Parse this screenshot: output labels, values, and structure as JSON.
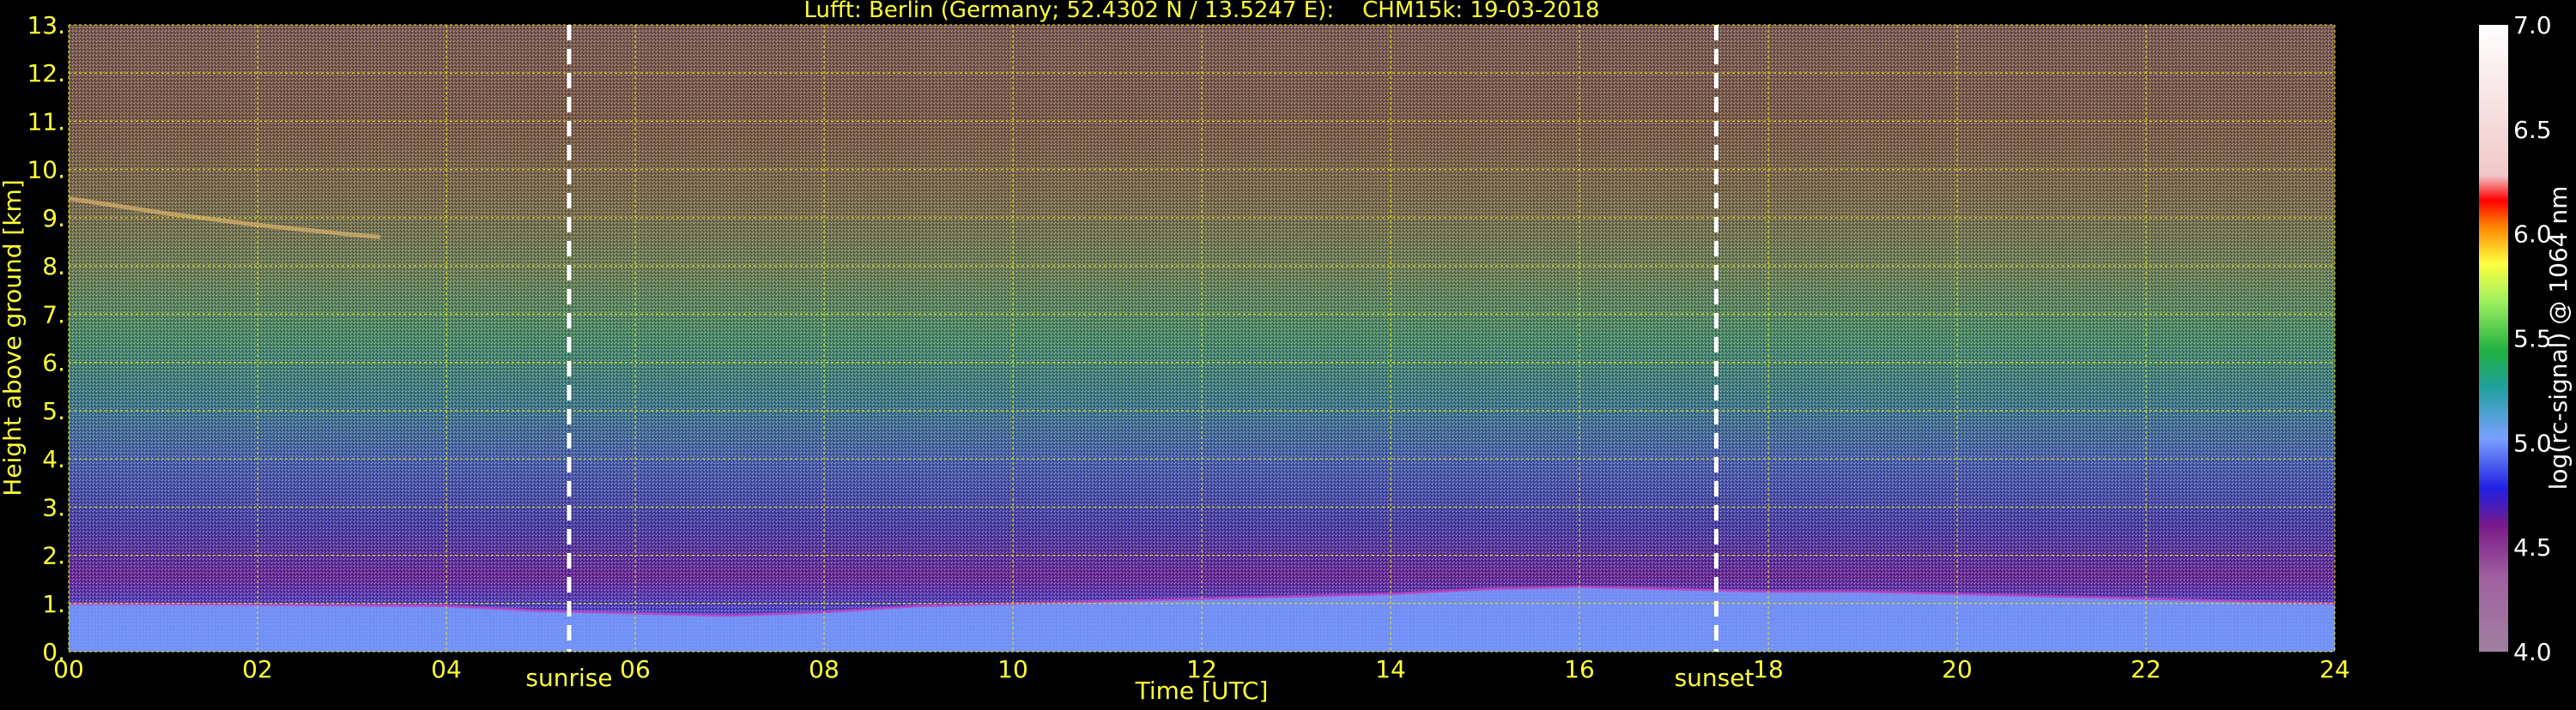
{
  "chart_data": {
    "type": "heatmap",
    "title": "Lufft: Berlin (Germany; 52.4302 N / 13.5247 E):    CHM15k: 19-03-2018",
    "xlabel": "Time [UTC]",
    "ylabel": "Height above ground [km]",
    "xlim": [
      0,
      24
    ],
    "ylim": [
      0,
      13
    ],
    "x_ticks": [
      "00",
      "02",
      "04",
      "06",
      "08",
      "10",
      "12",
      "14",
      "16",
      "18",
      "20",
      "22",
      "24"
    ],
    "y_ticks": [
      "0.",
      "1.",
      "2.",
      "3.",
      "4.",
      "5.",
      "6.",
      "7.",
      "8.",
      "9.",
      "10.",
      "11.",
      "12.",
      "13."
    ],
    "grid": true,
    "annotations": [
      {
        "label": "sunrise",
        "x": 5.3
      },
      {
        "label": "sunset",
        "x": 17.45
      }
    ],
    "colorbar": {
      "label": "log(rc-signal) @ 1064 nm",
      "range": [
        4.0,
        7.0
      ],
      "ticks": [
        "4.0",
        "4.5",
        "5.0",
        "5.5",
        "6.0",
        "6.5",
        "7.0"
      ]
    },
    "boundary_layer_top_km": {
      "x": [
        0,
        2,
        4,
        5,
        6,
        7,
        8,
        9,
        10,
        11,
        12,
        13,
        14,
        15,
        16,
        17,
        18,
        19,
        20,
        21,
        22,
        23,
        24
      ],
      "y": [
        1.0,
        0.98,
        0.95,
        0.85,
        0.8,
        0.75,
        0.82,
        0.95,
        1.0,
        1.05,
        1.1,
        1.15,
        1.2,
        1.3,
        1.35,
        1.3,
        1.25,
        1.25,
        1.2,
        1.15,
        1.1,
        1.05,
        1.0
      ]
    },
    "elevated_layer_km": {
      "x": [
        0,
        1,
        2,
        3,
        3.3
      ],
      "y": [
        9.4,
        9.1,
        8.85,
        8.65,
        8.6
      ]
    },
    "colors": {
      "axis_text": "#ffff33",
      "grid": "#e6e600",
      "marker_lines": "#ffffff"
    }
  }
}
